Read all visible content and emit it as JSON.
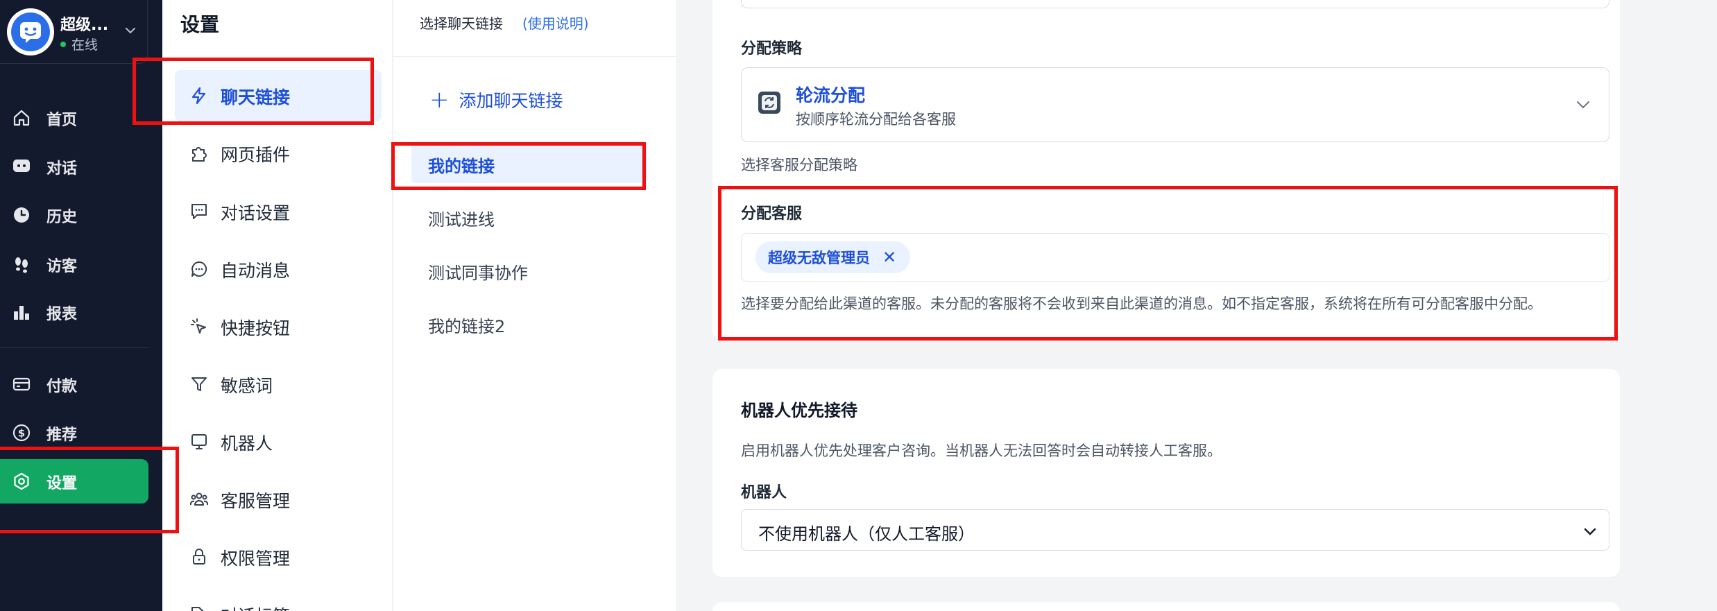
{
  "account": {
    "name": "超级...",
    "status": "在线"
  },
  "nav": {
    "items": [
      {
        "label": "首页",
        "icon": "home-icon"
      },
      {
        "label": "对话",
        "icon": "chat-icon"
      },
      {
        "label": "历史",
        "icon": "history-icon"
      },
      {
        "label": "访客",
        "icon": "footprints-icon"
      },
      {
        "label": "报表",
        "icon": "bar-chart-icon"
      },
      {
        "label": "付款",
        "icon": "credit-card-icon"
      },
      {
        "label": "推荐",
        "icon": "dollar-icon"
      },
      {
        "label": "设置",
        "icon": "settings-icon",
        "active": true
      }
    ]
  },
  "settings": {
    "title": "设置",
    "items": [
      {
        "label": "聊天链接",
        "icon": "lightning-icon",
        "active": true
      },
      {
        "label": "网页插件",
        "icon": "puzzle-icon"
      },
      {
        "label": "对话设置",
        "icon": "message-square-icon"
      },
      {
        "label": "自动消息",
        "icon": "message-circle-icon"
      },
      {
        "label": "快捷按钮",
        "icon": "cursor-click-icon"
      },
      {
        "label": "敏感词",
        "icon": "filter-icon"
      },
      {
        "label": "机器人",
        "icon": "monitor-icon"
      },
      {
        "label": "客服管理",
        "icon": "users-icon"
      },
      {
        "label": "权限管理",
        "icon": "lock-icon"
      },
      {
        "label": "对话标签",
        "icon": "tag-icon"
      }
    ]
  },
  "links": {
    "header": "选择聊天链接",
    "help": "(使用说明)",
    "add": "添加聊天链接",
    "items": [
      {
        "label": "我的链接",
        "active": true
      },
      {
        "label": "测试进线"
      },
      {
        "label": "测试同事协作"
      },
      {
        "label": "我的链接2"
      }
    ]
  },
  "form": {
    "strategy_label": "分配策略",
    "strategy_value": "轮流分配",
    "strategy_desc": "按顺序轮流分配给各客服",
    "strategy_hint": "选择客服分配策略",
    "agents_label": "分配客服",
    "agents": [
      "超级无敌管理员"
    ],
    "agents_hint": "选择要分配给此渠道的客服。未分配的客服将不会收到来自此渠道的消息。如不指定客服，系统将在所有可分配客服中分配。",
    "robot_section_title": "机器人优先接待",
    "robot_section_desc": "启用机器人优先处理客户咨询。当机器人无法回答时会自动转接人工客服。",
    "robot_label": "机器人",
    "robot_value": "不使用机器人（仅人工客服）"
  },
  "colors": {
    "nav_bg": "#141a2e",
    "nav_active": "#12a864",
    "accent": "#1e4fd8",
    "highlight": "#ee1111"
  }
}
